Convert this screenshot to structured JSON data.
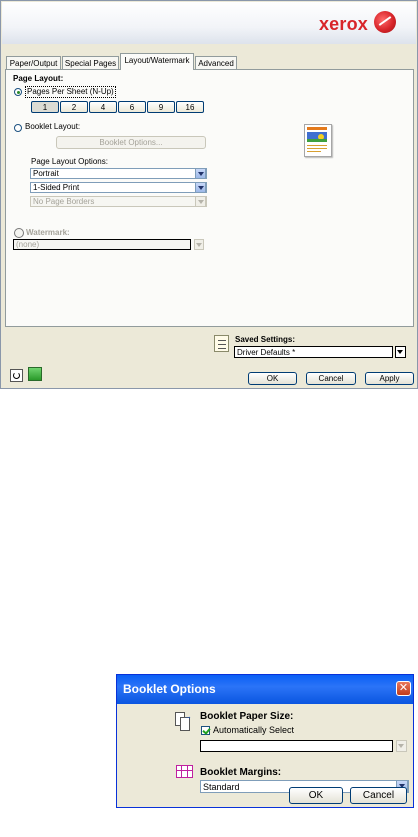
{
  "main_window": {
    "brand": "xerox",
    "tabs": [
      "Paper/Output",
      "Special Pages",
      "Layout/Watermark",
      "Advanced"
    ],
    "active_tab": "Layout/Watermark",
    "page_layout": {
      "heading": "Page Layout:",
      "pages_per_sheet_label": "Pages Per Sheet (N-Up)",
      "pages_options": [
        "1",
        "2",
        "4",
        "6",
        "9",
        "16"
      ],
      "selected_pages": "1",
      "booklet_layout_label": "Booklet Layout:",
      "booklet_options_button": "Booklet Options...",
      "layout_options_label": "Page Layout Options:",
      "orientation": "Portrait",
      "sides": "1-Sided Print",
      "borders": "No Page Borders"
    },
    "watermark": {
      "label": "Watermark:",
      "value": "(none)"
    },
    "saved_settings": {
      "label": "Saved Settings:",
      "value": "Driver Defaults *"
    },
    "buttons": {
      "ok": "OK",
      "cancel": "Cancel",
      "apply": "Apply"
    }
  },
  "booklet_dialog": {
    "title": "Booklet Options",
    "paper_size_label": "Booklet Paper Size:",
    "auto_select_label": "Automatically Select",
    "auto_select_checked": true,
    "paper_size_value": "",
    "margins_label": "Booklet Margins:",
    "margins_value": "Standard",
    "ok": "OK",
    "cancel": "Cancel"
  },
  "colors": {
    "xerox_red": "#d8252a",
    "window_face": "#ece9d8",
    "title_bar_blue": "#0a5ff5"
  }
}
